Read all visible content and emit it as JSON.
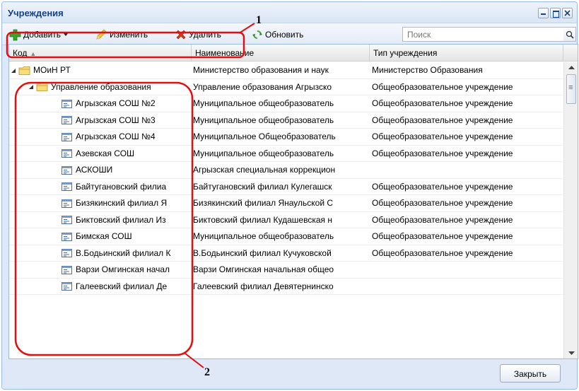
{
  "window": {
    "title": "Учреждения"
  },
  "toolbar": {
    "add_label": "Добавить",
    "edit_label": "Изменить",
    "delete_label": "Удалить",
    "refresh_label": "Обновить",
    "search_placeholder": "Поиск"
  },
  "grid": {
    "columns": [
      "Код",
      "Наименование",
      "Тип учреждения"
    ],
    "rows": [
      {
        "code": "МОиН РТ",
        "name": "Министерство образования и наук",
        "type": "Министерство Образования",
        "level": 0,
        "icon": "folder-icon",
        "expanded": true
      },
      {
        "code": "Управление образования",
        "name": "Управление образования Агрызско",
        "type": "Общеобразовательное учреждение",
        "level": 1,
        "icon": "folder-icon",
        "expanded": true
      },
      {
        "code": "Агрызская СОШ №2",
        "name": "Муниципальное общеобразователь",
        "type": "Общеобразовательное учреждение",
        "level": 2,
        "icon": "record-icon"
      },
      {
        "code": "Агрызская СОШ №3",
        "name": "Муниципальное общеобразователь",
        "type": "Общеобразовательное учреждение",
        "level": 2,
        "icon": "record-icon"
      },
      {
        "code": "Агрызская СОШ №4",
        "name": "Муниципальное Общеобразователь",
        "type": "Общеобразовательное учреждение",
        "level": 2,
        "icon": "record-icon"
      },
      {
        "code": "Азевская СОШ",
        "name": "Муниципальное общеобразователь",
        "type": "Общеобразовательное учреждение",
        "level": 2,
        "icon": "record-icon"
      },
      {
        "code": "АСКОШИ",
        "name": "Агрызская специальная коррекцион",
        "type": "",
        "level": 2,
        "icon": "record-icon"
      },
      {
        "code": "Байтугановский филиа",
        "name": "Байтугановский филиал Кулегашск",
        "type": "Общеобразовательное учреждение",
        "level": 2,
        "icon": "record-icon"
      },
      {
        "code": "Бизякинский филиал Я",
        "name": "Бизякинский филиал Янаульской С",
        "type": "Общеобразовательное учреждение",
        "level": 2,
        "icon": "record-icon"
      },
      {
        "code": "Биктовский филиал Из",
        "name": "Биктовский филиал Кудашевская н",
        "type": "Общеобразовательное учреждение",
        "level": 2,
        "icon": "record-icon"
      },
      {
        "code": "Бимская СОШ",
        "name": "Муниципальное общеобразователь",
        "type": "Общеобразовательное учреждение",
        "level": 2,
        "icon": "record-icon"
      },
      {
        "code": "В.Бодьинский филиал К",
        "name": "В.Бодьинский филиал Кучуковской",
        "type": "Общеобразовательное учреждение",
        "level": 2,
        "icon": "record-icon"
      },
      {
        "code": "Варзи Омгинская начал",
        "name": "Варзи Омгинская начальная общео",
        "type": "",
        "level": 2,
        "icon": "record-icon"
      },
      {
        "code": "Галеевский филиал Де",
        "name": "Галеевский филиал Девятернинско",
        "type": "",
        "level": 2,
        "icon": "record-icon"
      }
    ]
  },
  "footer": {
    "close_label": "Закрыть"
  },
  "annotations": {
    "marker_1": "1",
    "marker_2": "2"
  },
  "colors": {
    "title_text": "#15428b",
    "window_bg": "#dfe8f6",
    "add_icon": "#3aa52c",
    "delete_icon": "#d43a1a",
    "folder_icon": "#f3c84a",
    "annotation": "#e01010"
  }
}
